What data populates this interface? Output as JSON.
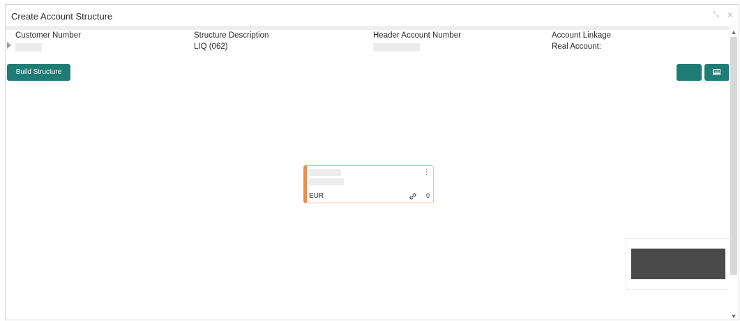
{
  "window": {
    "title": "Create Account Structure",
    "controls": {
      "minimize": "⤡",
      "close": "×"
    }
  },
  "header": {
    "fields": [
      {
        "label": "Customer Number",
        "value": ""
      },
      {
        "label": "Structure Description",
        "value": "LIQ (062)"
      },
      {
        "label": "Header Account Number",
        "value": ""
      },
      {
        "label": "Account Linkage",
        "value": "Real Account:"
      }
    ]
  },
  "toolbar": {
    "build_label": "Build Structure",
    "accent": "#1f7b75",
    "icons": [
      "blank-icon",
      "grid-view-icon"
    ]
  },
  "node": {
    "currency": "EUR",
    "link_count": "0",
    "menu_glyph": "⋮",
    "accent": "#f28a4b",
    "icon": "link-icon"
  },
  "scroll": {
    "up": "▲",
    "down": "▼"
  }
}
